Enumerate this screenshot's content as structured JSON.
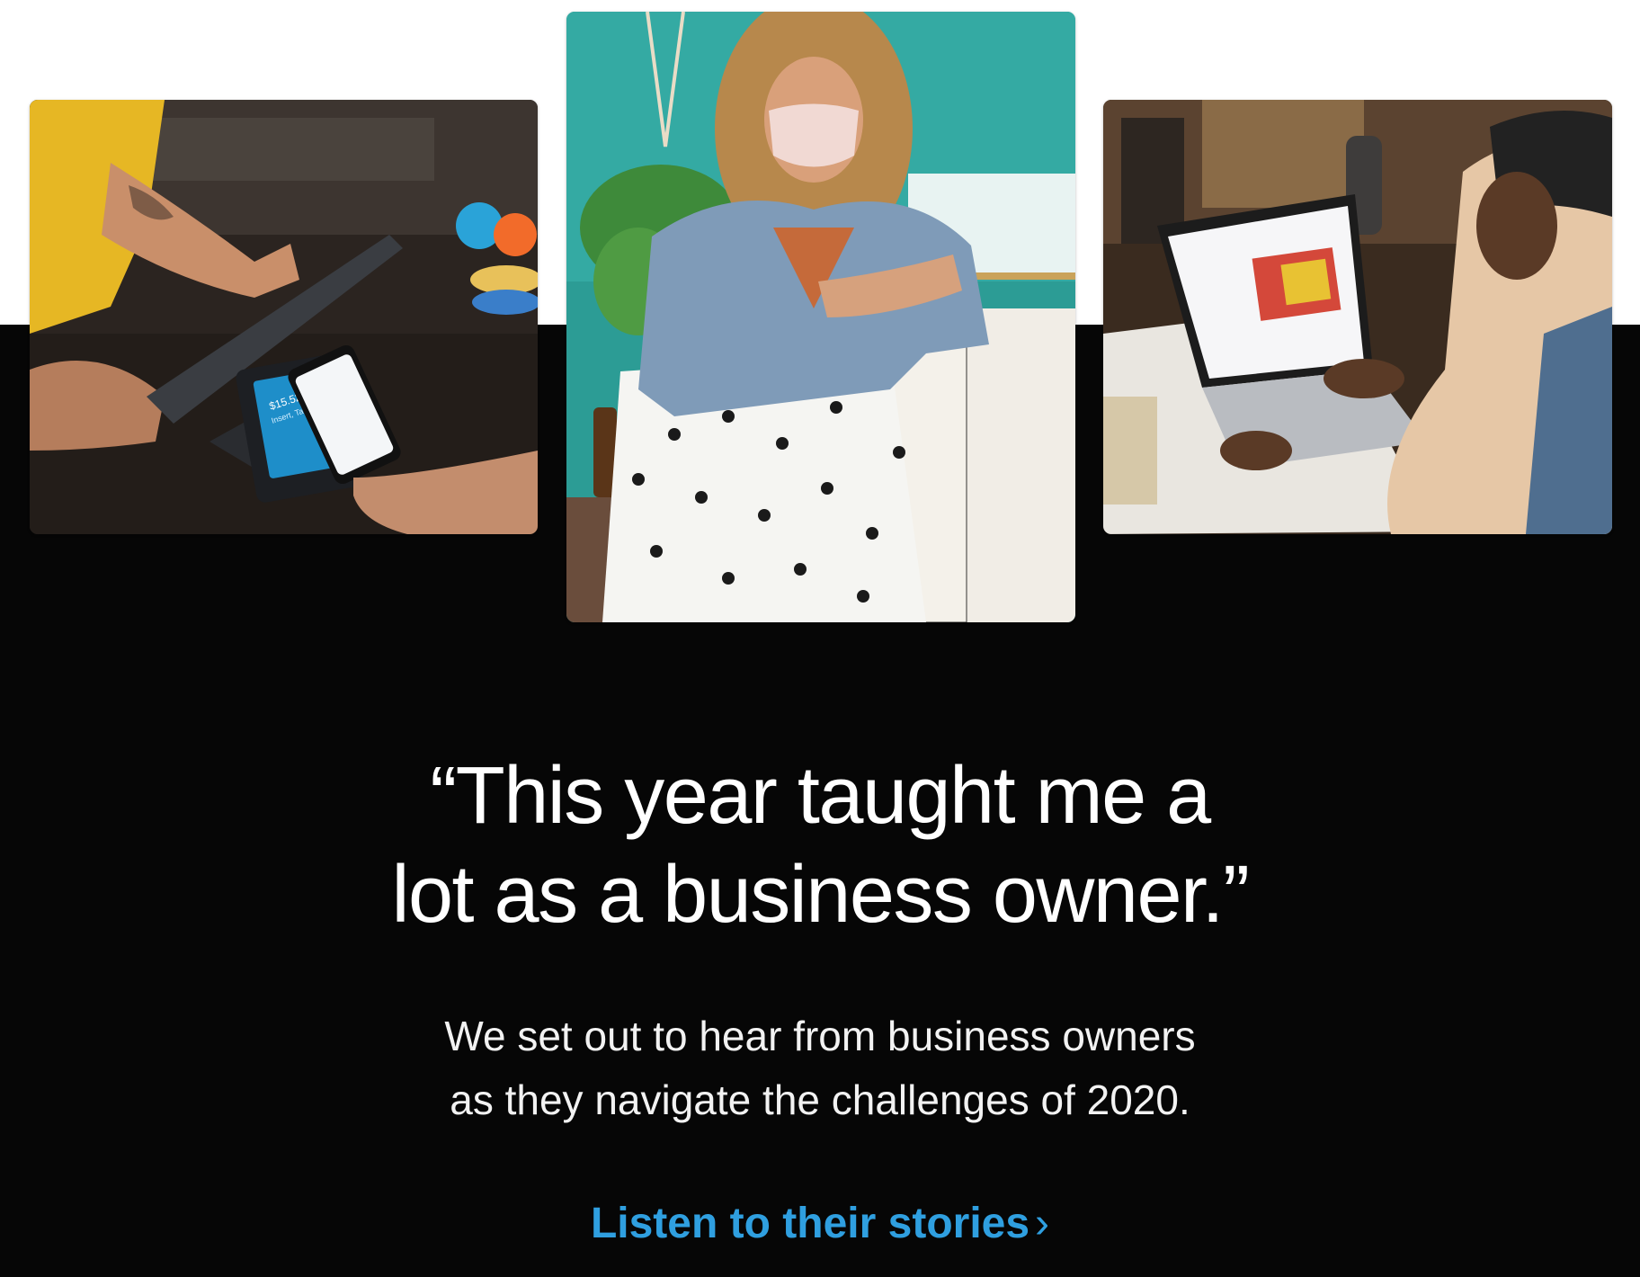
{
  "images": {
    "left": {
      "name": "customer-paying-with-phone-photo"
    },
    "center": {
      "name": "business-owner-in-mask-photo"
    },
    "right": {
      "name": "owner-using-laptop-photo"
    }
  },
  "pos_screen": {
    "amount": "$15.52",
    "prompt": "Insert, Tap or Swipe"
  },
  "headline": {
    "line1": "“This year taught me a",
    "line2": "lot as a business owner.”"
  },
  "subtext": {
    "line1": "We set out to hear from business owners",
    "line2": "as they navigate the challenges of 2020."
  },
  "cta": {
    "label": "Listen to their stories",
    "chevron": "›"
  },
  "colors": {
    "background": "#060606",
    "top_band": "#ffffff",
    "link": "#2f9fe0",
    "text": "#ffffff"
  }
}
